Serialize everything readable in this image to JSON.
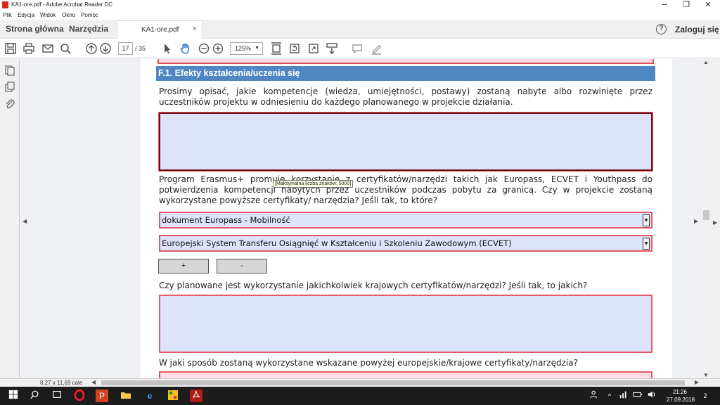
{
  "window": {
    "title": "KA1-ore.pdf - Adobe Acrobat Reader DC",
    "buttons": {
      "minimize": "─",
      "maximize": "❐",
      "close": "✕"
    }
  },
  "menu": [
    "Plik",
    "Edycja",
    "Widok",
    "Okno",
    "Pomoc"
  ],
  "nav": {
    "home": "Strona główna",
    "tools": "Narzędzia",
    "tab": "KA1-ore.pdf",
    "tab_close": "×",
    "help": "?",
    "login": "Zaloguj się"
  },
  "toolbar": {
    "page_current": "17",
    "page_total": "/ 35",
    "zoom": "125%"
  },
  "document": {
    "section_title": "F.1. Efekty kształcenia/uczenia się",
    "para1": "Prosimy opisać, jakie kompetencje (wiedza, umiejętności, postawy) zostaną nabyte albo rozwinięte przez uczestników projektu w odniesieniu do każdego planowanego w projekcie działania.",
    "para2": "Program Erasmus+ promuje korzystanie z certyfikatów/narzędzi takich jak Europass, ECVET i Youthpass do potwierdzenia kompetencji nabytych przez uczestników podczas pobytu za granicą. Czy w projekcie zostaną wykorzystane powyższe certyfikaty/ narzędzia? Jeśli tak, to które?",
    "tooltip": "[Maksymalna liczba znaków: 5000]",
    "dropdown1": "dokument Europass - Mobilność",
    "dropdown2": "Europejski System Transferu Osiągnięć w Kształceniu i Szkoleniu Zawodowym (ECVET)",
    "add_button": "+",
    "remove_button": "-",
    "para3": "Czy planowane jest wykorzystanie jakichkolwiek krajowych certyfikatów/narzędzi? Jeśli tak, to jakich?",
    "para4": "W jaki sposób zostaną wykorzystane wskazane powyżej europejskie/krajowe certyfikaty/narzędzia?"
  },
  "status": {
    "page_size": "8,27 x 11,69 cale"
  },
  "taskbar": {
    "time": "21:26",
    "date": "27.09.2018",
    "notifications": "2"
  },
  "colors": {
    "section_bg": "#4f87c4",
    "field_bg": "#dde3fb",
    "field_border": "#e15a66"
  }
}
